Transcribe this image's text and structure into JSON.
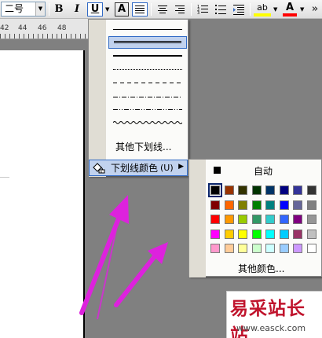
{
  "toolbar": {
    "font_size": "二号",
    "bold_label": "B",
    "italic_label": "I",
    "underline_label": "U",
    "char_border_label": "A",
    "highlight_label": "ab",
    "font_color_label": "A",
    "accent_color": "#316ac5"
  },
  "ruler": {
    "ticks": [
      "42",
      "44",
      "46",
      "48"
    ]
  },
  "underline_menu": {
    "line_styles": [
      "single",
      "double",
      "thick",
      "dotted",
      "dashed",
      "dash-dot",
      "dash-dot-dot",
      "wave"
    ],
    "selected_style": "double",
    "other_underlines": "其他下划线...",
    "underline_color": "下划线颜色",
    "underline_color_shortcut": "(U)"
  },
  "color_panel": {
    "auto_label": "自动",
    "more_colors": "其他颜色...",
    "selected_color": "#000000",
    "colors": [
      [
        "#000000",
        "#993300",
        "#333300",
        "#003300",
        "#003366",
        "#000080",
        "#333399",
        "#333333"
      ],
      [
        "#800000",
        "#ff6600",
        "#808000",
        "#008000",
        "#008080",
        "#0000ff",
        "#666699",
        "#808080"
      ],
      [
        "#ff0000",
        "#ff9900",
        "#99cc00",
        "#339966",
        "#33cccc",
        "#3366ff",
        "#800080",
        "#969696"
      ],
      [
        "#ff00ff",
        "#ffcc00",
        "#ffff00",
        "#00ff00",
        "#00ffff",
        "#00ccff",
        "#993366",
        "#c0c0c0"
      ],
      [
        "#ff99cc",
        "#ffcc99",
        "#ffff99",
        "#ccffcc",
        "#ccffff",
        "#99ccff",
        "#cc99ff",
        "#ffffff"
      ]
    ]
  },
  "annotation_arrows": {
    "count": 3,
    "color": "#dd22dd"
  },
  "watermark": {
    "title": "易采站长站",
    "url": "www.easck.com"
  }
}
